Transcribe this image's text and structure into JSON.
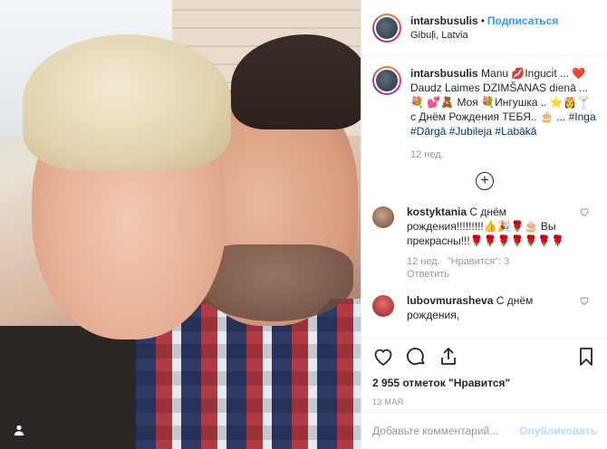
{
  "post": {
    "username": "intarsbusulis",
    "follow_label": "Подписаться",
    "location": "Gibuļi, Latvia",
    "caption_user": "intarsbusulis",
    "caption_text": " Manu 💋Inguci̇t ... ❤️ Daudz Laimes DZIMŠANAS dienā ... 💐 💕🧸 Моя 💐Ингушка .. ⭐👸🍸 с Днём Рождения ТЕБЯ.. 🎂 ... ",
    "caption_tags": [
      "#Inga",
      "#Dārgā",
      "#Jubileja",
      "#Labākā"
    ],
    "caption_time": "12 нед.",
    "likes": "2 955 отметок \"Нравится\"",
    "date": "13 МАЯ",
    "comment_placeholder": "Добавьте комментарий...",
    "publish_label": "Опубликовать"
  },
  "comments": [
    {
      "username": "kostyktania",
      "text": " С днём рождения!!!!!!!!!👍🎉🌹🎂 Вы прекрасны!!!🌹🌹🌹🌹🌹🌹🌹",
      "time": "12 нед.",
      "likes": "\"Нравится\": 3",
      "reply": "Ответить"
    },
    {
      "username": "lubovmurasheva",
      "text": " С днём рождения,",
      "time": "",
      "likes": "",
      "reply": ""
    }
  ],
  "icons": {
    "load_more": "plus-circle-icon",
    "like": "heart-icon",
    "comment": "comment-icon",
    "share": "share-icon",
    "save": "bookmark-icon",
    "tagged_user": "user-icon"
  },
  "colors": {
    "link": "#3897f0",
    "hashtag": "#003569",
    "muted": "#999999",
    "publish_disabled": "#b2dffc"
  }
}
